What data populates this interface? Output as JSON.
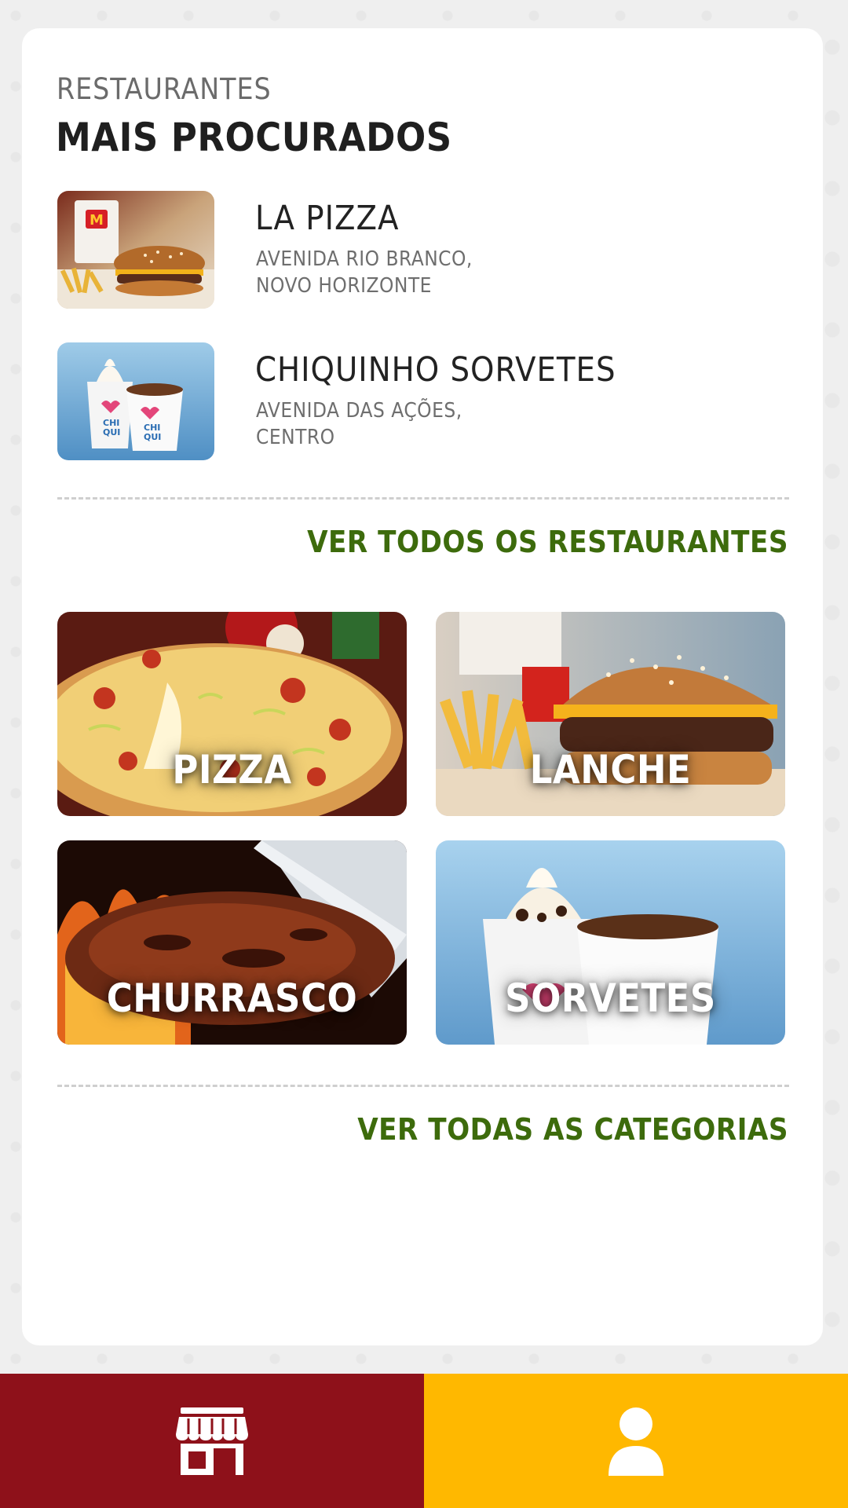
{
  "header": {
    "eyebrow": "RESTAURANTES",
    "title": "MAIS PROCURADOS"
  },
  "restaurants": [
    {
      "name": "LA PIZZA",
      "address_line1": "AVENIDA RIO BRANCO,",
      "address_line2": "NOVO HORIZONTE",
      "image": "burger-fries-photo"
    },
    {
      "name": "CHIQUINHO SORVETES",
      "address_line1": "AVENIDA DAS AÇÕES,",
      "address_line2": "CENTRO",
      "image": "ice-cream-cups-photo"
    }
  ],
  "links": {
    "all_restaurants": "VER TODOS OS RESTAURANTES",
    "all_categories": "VER TODAS AS CATEGORIAS"
  },
  "categories": [
    {
      "label": "PIZZA",
      "image": "pizza-photo"
    },
    {
      "label": "LANCHE",
      "image": "burger-photo"
    },
    {
      "label": "CHURRASCO",
      "image": "grilled-meat-photo"
    },
    {
      "label": "SORVETES",
      "image": "ice-cream-photo"
    }
  ],
  "bottom_nav": {
    "items": [
      {
        "icon": "store-icon",
        "color": "#8e111a"
      },
      {
        "icon": "user-icon",
        "color": "#ffb800"
      }
    ]
  },
  "colors": {
    "link_green": "#3d6b0c",
    "brand_red": "#8e111a",
    "brand_yellow": "#ffb800"
  }
}
